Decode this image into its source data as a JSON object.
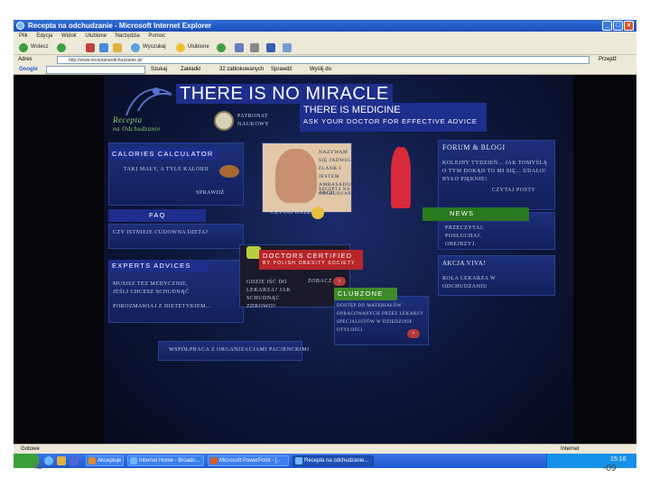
{
  "window": {
    "title": "Recepta na odchudzanie - Microsoft Internet Explorer",
    "minimize": "_",
    "maximize": "□",
    "close": "×"
  },
  "menu": [
    "Plik",
    "Edycja",
    "Widok",
    "Ulubione",
    "Narzędzia",
    "Pomoc"
  ],
  "toolbar": {
    "back_label": "Wstecz",
    "search_label": "Wyszukaj",
    "favorites_label": "Ulubione"
  },
  "address": {
    "label": "Adres",
    "url": "http://www.receptanaodchudzanie.pl/",
    "go": "Przejdź"
  },
  "google_bar": {
    "brand": "Google",
    "items": [
      "Szukaj",
      "Zakładki",
      "32 zablokowanych",
      "Sprawdź",
      "Wyślij do"
    ]
  },
  "site": {
    "logo_line1": "Recepta",
    "logo_line2": "na Odchudzanie",
    "patronat": "Patronat Naukowy",
    "calculator_text": "Taki mały, a tyle kalorii",
    "calculator_link": "Sprawdź",
    "intro_text": "Nazywam się Jadwiga Flank i jestem Ambasadorem akcji",
    "intro_brand": "Recepta na Odchudzanie",
    "listen": "Czytaj dalej",
    "forum_title": "Forum & Blogi",
    "forum_text": "Kolejny tydzień... jak tomyślą o tym dokąd to mi się... udało! Było pięknie!",
    "forum_link": "Czytaj posty",
    "faq_text": "Czy istnieje cudowna dieta?",
    "news_text": "Przeczytaj. Posłuchaj. Obejrzyj.",
    "expert_text": "Musisz tez medycznie, jeśli chcesz schudnąć",
    "expert_link": "Porozmawiaj z dietetykiem...",
    "doctors_text": "Gdzie iść do lekarza? Jak schudnąć zdrowo?",
    "doctors_link": "Zobacz",
    "viva_title": "Akcja VIVA!",
    "viva_text": "Rola lekarza w odchudzaniu",
    "club_text": "Dostęp do materiałów opracowanych przez lekarzy specjalistów w dziedzinie otyłości",
    "partners_text": "Współpraca z organizacjami pacjenckimi"
  },
  "overlay": {
    "big_title": "THERE IS NO MIRACLE",
    "medicine_title": "THERE IS MEDICINE",
    "medicine_sub": "ASK YOUR DOCTOR FOR EFFECTIVE ADVICE",
    "calories": "CALORIES CALCULATOR",
    "faq": "FAQ",
    "news": "NEWS",
    "doctors_title": "DOCTORS CERTIFIED",
    "doctors_sub": "BY POLISH OBESITY SOCIETY",
    "experts": "EXPERTS ADVICES",
    "clubzone": "CLUBZONE"
  },
  "status": {
    "left": "Gotowe",
    "right": "Internet"
  },
  "taskbar": [
    {
      "label": "Akceptuje",
      "color": "#e08a2a"
    },
    {
      "label": "Internet Home - Broadc...",
      "color": "#6fb8ff"
    },
    {
      "label": "Microsoft PowerPoint - [..",
      "color": "#d65a2a"
    },
    {
      "label": "Recepta na odchudzanie...",
      "color": "#6fb8ff"
    }
  ],
  "clock": "15:16",
  "slide": {
    "number": "42",
    "date": "-09"
  },
  "colors": {
    "overlay_blue": "#1e2e8c",
    "doctors_red": "#b8262a",
    "clubzone_green": "#3e8a2a",
    "news_green": "#3e8a2a"
  }
}
